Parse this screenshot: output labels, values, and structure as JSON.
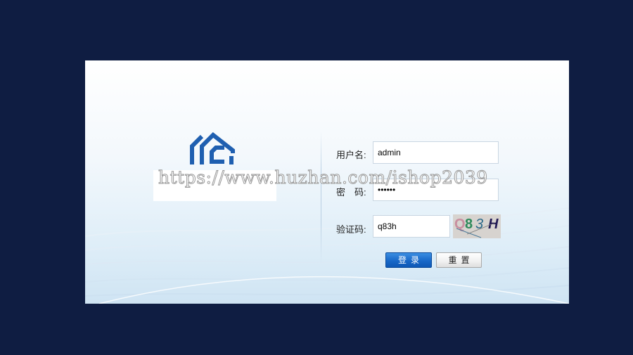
{
  "login": {
    "username_label": "用户名:",
    "username_value": "admin",
    "password_label": "密　码:",
    "password_value": "••••••",
    "captcha_label": "验证码:",
    "captcha_value": "q83h",
    "captcha_image_text": "Q83H",
    "login_button": "登录",
    "reset_button": "重置"
  },
  "watermark": "https://www.huzhan.com/ishop2039",
  "colors": {
    "background": "#0f1d42",
    "logo_blue": "#1f5fb0",
    "login_button": "#1868c8"
  },
  "icons": {
    "logo": "house-logo-icon"
  }
}
